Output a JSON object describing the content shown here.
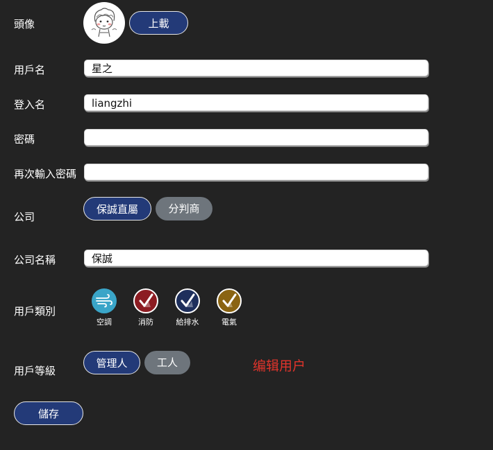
{
  "avatar": {
    "label": "頭像",
    "upload_label": "上載"
  },
  "username": {
    "label": "用戶名",
    "value": "星之"
  },
  "login_name": {
    "label": "登入名",
    "value": "liangzhi"
  },
  "password": {
    "label": "密碼",
    "value": ""
  },
  "password_confirm": {
    "label": "再次輸入密碼",
    "value": ""
  },
  "company": {
    "label": "公司",
    "options": [
      {
        "label": "保誠直屬",
        "selected": true
      },
      {
        "label": "分判商",
        "selected": false
      }
    ]
  },
  "company_name": {
    "label": "公司名稱",
    "value": "保誠"
  },
  "user_category": {
    "label": "用戶類別",
    "items": [
      {
        "label": "空調",
        "icon": "wind-icon",
        "color": "#3aa5c8",
        "checked": false
      },
      {
        "label": "消防",
        "icon": "checkmark-icon",
        "color": "#8c1c22",
        "checked": true
      },
      {
        "label": "給排水",
        "icon": "checkmark-icon",
        "color": "#1e2f5c",
        "checked": true
      },
      {
        "label": "電氣",
        "icon": "checkmark-icon",
        "color": "#8a6412",
        "checked": true
      }
    ]
  },
  "user_level": {
    "label": "用戶等級",
    "options": [
      {
        "label": "管理人",
        "selected": true
      },
      {
        "label": "工人",
        "selected": false
      }
    ]
  },
  "page_title": "编辑用户",
  "save_label": "儲存",
  "colors": {
    "primary": "#233a78",
    "secondary": "#6e757c",
    "background": "#232323",
    "title": "#e0342b"
  }
}
